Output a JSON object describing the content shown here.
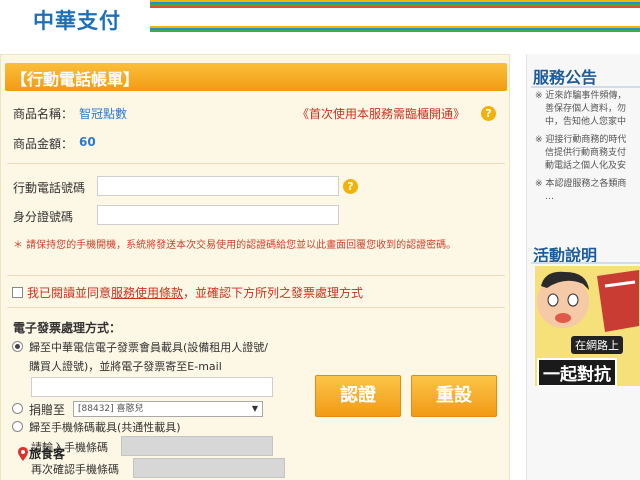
{
  "header": {
    "logo_text": "中華支付",
    "stripe_colors": [
      "#f4b400",
      "#2c8bd8",
      "#3aae49",
      "#e04f2f"
    ]
  },
  "form": {
    "title": "【行動電話帳單】",
    "product_name_label": "商品名稱：",
    "product_name_value": "智冠點數",
    "first_use_notice": "《首次使用本服務需臨櫃開通》",
    "amount_label": "商品金額：",
    "amount_value": "60",
    "phone_label": "行動電話號碼",
    "phone_value": "",
    "id_label": "身分證號碼",
    "id_value": "",
    "warning": "＊ 請保持您的手機開機，系統將發送本次交易使用的認證碼給您並以此畫面回覆您收到的認證密碼。",
    "agree_prefix": "我已閱讀並同意",
    "agree_link": "服務使用條款",
    "agree_suffix": "，並確認下方所列之發票處理方式",
    "invoice_heading": "電子發票處理方式：",
    "option1_line1": "歸至中華電信電子發票會員載具(設備租用人證號/",
    "option1_line2": "購買人證號)，並將電子發票寄至E-mail",
    "email_value": "",
    "option2_label": "捐贈至",
    "donate_selected": "[88432] 喜憨兒",
    "option3_label": "歸至手機條碼載具(共通性載具)",
    "barcode_label": "請輸入手機條碼",
    "barcode_confirm_label": "再次確認手機條碼",
    "confirm_button": "認證",
    "reset_button": "重設"
  },
  "sidebar": {
    "announce_title": "服務公告",
    "announcements": [
      "近來詐騙事件頻傳，",
      "善保存個人資料，勿",
      "中，告知他人您家中",
      "迎接行動商務的時代",
      "信提供行動商務支付",
      "動電話之個人化及安",
      "本認證服務之各類商",
      "…"
    ],
    "event_title": "活動說明",
    "banner_caption1": "在網路上",
    "banner_caption2": "一起對抗"
  },
  "footer": {
    "brand": "旅食客"
  }
}
